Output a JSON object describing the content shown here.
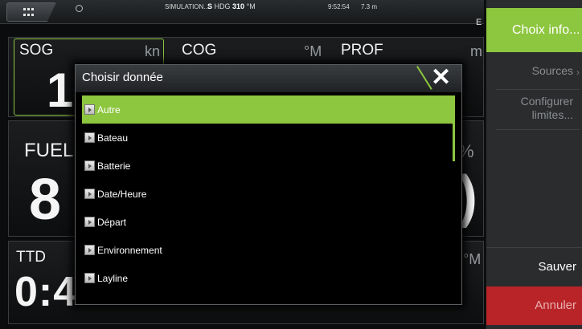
{
  "statusbar": {
    "simulation": "SIMULATION...",
    "hdg_prefix": "S",
    "hdg_label": "HDG",
    "hdg_value": "310",
    "hdg_unit": "°M",
    "time": "9:52:54",
    "distance": "7.3 m",
    "edge_letter": "E"
  },
  "gauges": {
    "sog": {
      "label": "SOG",
      "unit": "kn",
      "value": "1"
    },
    "cog": {
      "label": "COG",
      "unit": "°M"
    },
    "prof": {
      "label": "PROF",
      "unit": "m"
    },
    "fuel": {
      "label": "FUEL",
      "value": "8",
      "unit": "%",
      "right_value": ")"
    },
    "ttd": {
      "label": "TTD",
      "value": "0:4",
      "unit": "°M"
    }
  },
  "dialog": {
    "title": "Choisir donnée",
    "items": [
      {
        "label": "Autre",
        "selected": true
      },
      {
        "label": "Bateau",
        "selected": false
      },
      {
        "label": "Batterie",
        "selected": false
      },
      {
        "label": "Date/Heure",
        "selected": false
      },
      {
        "label": "Départ",
        "selected": false
      },
      {
        "label": "Environnement",
        "selected": false
      },
      {
        "label": "Layline",
        "selected": false
      }
    ]
  },
  "right_panel": {
    "choix_info": "Choix info...",
    "sources": "Sources",
    "configurer_line1": "Configurer",
    "configurer_line2": "limites...",
    "sauver": "Sauver",
    "annuler": "Annuler"
  },
  "colors": {
    "accent": "#8dc63f",
    "cancel": "#b82428",
    "panel": "#2a2c2e"
  },
  "icons": {
    "menu": "grid-menu-icon",
    "globe": "globe-icon",
    "close": "close-icon",
    "expand": "expand-arrow-icon",
    "chevron": "chevron-right-icon"
  }
}
